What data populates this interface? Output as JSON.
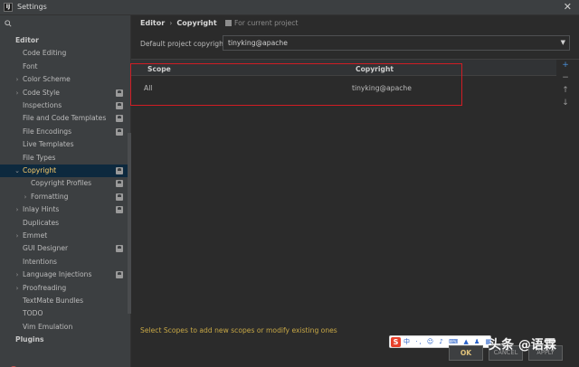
{
  "window": {
    "title": "Settings"
  },
  "sidebar": {
    "search_placeholder": "",
    "items": [
      {
        "label": "Editor",
        "level": 0,
        "expander": "",
        "badge": false,
        "header": true,
        "selected": false
      },
      {
        "label": "Code Editing",
        "level": 1,
        "expander": "",
        "badge": false,
        "header": false,
        "selected": false
      },
      {
        "label": "Font",
        "level": 1,
        "expander": "",
        "badge": false,
        "header": false,
        "selected": false
      },
      {
        "label": "Color Scheme",
        "level": 1,
        "expander": "›",
        "badge": false,
        "header": false,
        "selected": false
      },
      {
        "label": "Code Style",
        "level": 1,
        "expander": "›",
        "badge": true,
        "header": false,
        "selected": false
      },
      {
        "label": "Inspections",
        "level": 1,
        "expander": "",
        "badge": true,
        "header": false,
        "selected": false
      },
      {
        "label": "File and Code Templates",
        "level": 1,
        "expander": "",
        "badge": true,
        "header": false,
        "selected": false
      },
      {
        "label": "File Encodings",
        "level": 1,
        "expander": "",
        "badge": true,
        "header": false,
        "selected": false
      },
      {
        "label": "Live Templates",
        "level": 1,
        "expander": "",
        "badge": false,
        "header": false,
        "selected": false
      },
      {
        "label": "File Types",
        "level": 1,
        "expander": "",
        "badge": false,
        "header": false,
        "selected": false
      },
      {
        "label": "Copyright",
        "level": 1,
        "expander": "⌄",
        "badge": true,
        "header": false,
        "selected": true
      },
      {
        "label": "Copyright Profiles",
        "level": 2,
        "expander": "",
        "badge": true,
        "header": false,
        "selected": false
      },
      {
        "label": "Formatting",
        "level": 2,
        "expander": "›",
        "badge": true,
        "header": false,
        "selected": false
      },
      {
        "label": "Inlay Hints",
        "level": 1,
        "expander": "›",
        "badge": true,
        "header": false,
        "selected": false
      },
      {
        "label": "Duplicates",
        "level": 1,
        "expander": "",
        "badge": false,
        "header": false,
        "selected": false
      },
      {
        "label": "Emmet",
        "level": 1,
        "expander": "›",
        "badge": false,
        "header": false,
        "selected": false
      },
      {
        "label": "GUI Designer",
        "level": 1,
        "expander": "",
        "badge": true,
        "header": false,
        "selected": false
      },
      {
        "label": "Intentions",
        "level": 1,
        "expander": "",
        "badge": false,
        "header": false,
        "selected": false
      },
      {
        "label": "Language Injections",
        "level": 1,
        "expander": "›",
        "badge": true,
        "header": false,
        "selected": false
      },
      {
        "label": "Proofreading",
        "level": 1,
        "expander": "›",
        "badge": false,
        "header": false,
        "selected": false
      },
      {
        "label": "TextMate Bundles",
        "level": 1,
        "expander": "",
        "badge": false,
        "header": false,
        "selected": false
      },
      {
        "label": "TODO",
        "level": 1,
        "expander": "",
        "badge": false,
        "header": false,
        "selected": false
      },
      {
        "label": "Vim Emulation",
        "level": 1,
        "expander": "",
        "badge": false,
        "header": false,
        "selected": false
      },
      {
        "label": "Plugins",
        "level": 0,
        "expander": "",
        "badge": false,
        "header": true,
        "selected": false
      }
    ]
  },
  "breadcrumb": {
    "parent": "Editor",
    "separator": "›",
    "current": "Copyright"
  },
  "scope_note": "For current project",
  "default_copyright": {
    "label": "Default project copyright:",
    "value": "tinyking@apache"
  },
  "table": {
    "headers": {
      "scope": "Scope",
      "copyright": "Copyright"
    },
    "rows": [
      {
        "scope": "All",
        "copyright": "tinyking@apache"
      }
    ]
  },
  "tools": {
    "add": "+",
    "remove": "−",
    "up": "↑",
    "down": "↓"
  },
  "ime": {
    "logo": "S",
    "items": "中 ·, ☺ ♪ ⌨ ▲ ♟ ▦"
  },
  "hint": "Select Scopes to add new scopes or modify existing ones",
  "footer": {
    "ok": "OK",
    "cancel": "CANCEL",
    "apply": "APPLY"
  },
  "watermark": "头条 @语霖",
  "colors": {
    "selected_label": "#ffcf6b",
    "highlight_box": "#d01c24",
    "hint_text": "#c8a846",
    "help_icon": "#c75450"
  }
}
